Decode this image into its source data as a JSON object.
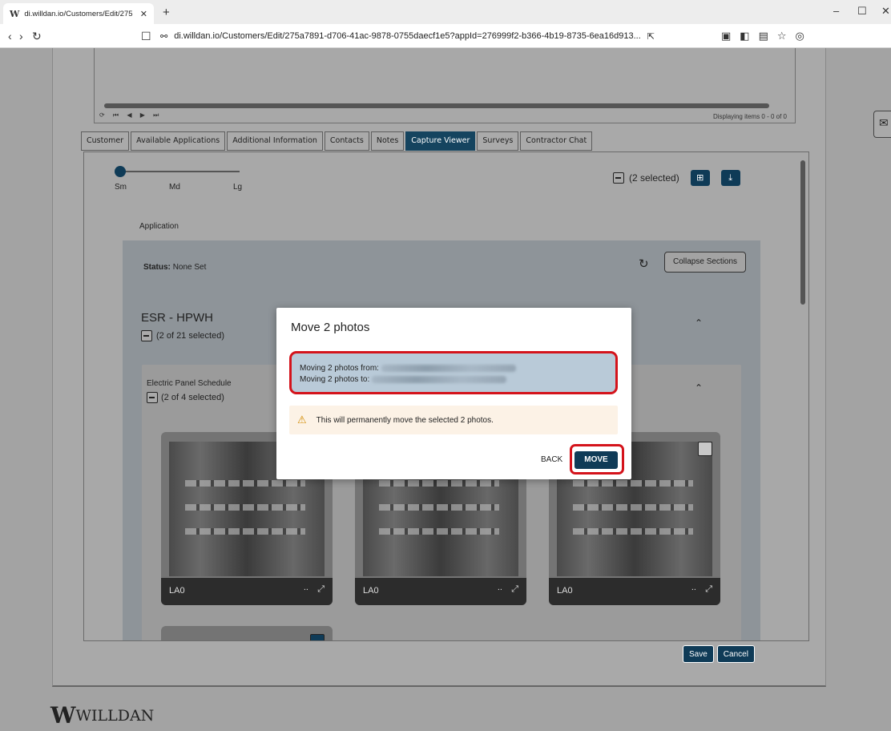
{
  "browser": {
    "tab_title": "di.willdan.io/Customers/Edit/275",
    "tab_favicon": "W",
    "url": "di.willdan.io/Customers/Edit/275a7891-d706-41ac-9878-0755daecf1e5?appId=276999f2-b366-4b19-8735-6ea16d913..."
  },
  "grid": {
    "paging_text": "Displaying items 0 - 0 of 0"
  },
  "tabs": [
    "Customer",
    "Available Applications",
    "Additional Information",
    "Contacts",
    "Notes",
    "Capture Viewer",
    "Surveys",
    "Contractor Chat"
  ],
  "active_tab": "Capture Viewer",
  "size_slider": {
    "labels": [
      "Sm",
      "Md",
      "Lg"
    ],
    "selected": "Sm"
  },
  "selection": {
    "text": "(2 selected)"
  },
  "application": {
    "label": "Application",
    "status_label": "Status:",
    "status_value": "None Set",
    "collapse_label": "Collapse Sections",
    "section_title": "ESR - HPWH",
    "section_selection": "(2 of 21 selected)",
    "subsection_title": "Electric Panel Schedule",
    "subsection_selection": "(2 of 4 selected)",
    "photos": [
      {
        "caption": "LA0",
        "more": ".."
      },
      {
        "caption": "LA0",
        "more": ".."
      },
      {
        "caption": "LA0",
        "more": ".."
      }
    ]
  },
  "footer": {
    "save_label": "Save",
    "cancel_label": "Cancel",
    "logo_text": "WILLDAN"
  },
  "modal": {
    "title": "Move 2 photos",
    "from_label": "Moving 2 photos from:",
    "to_label": "Moving 2 photos to:",
    "warning": "This will permanently move the selected 2 photos.",
    "back_label": "BACK",
    "move_label": "MOVE"
  },
  "colors": {
    "accent": "#0f3b57",
    "highlight_ring": "#d4131b",
    "warning_bg": "#fcf2e6"
  }
}
